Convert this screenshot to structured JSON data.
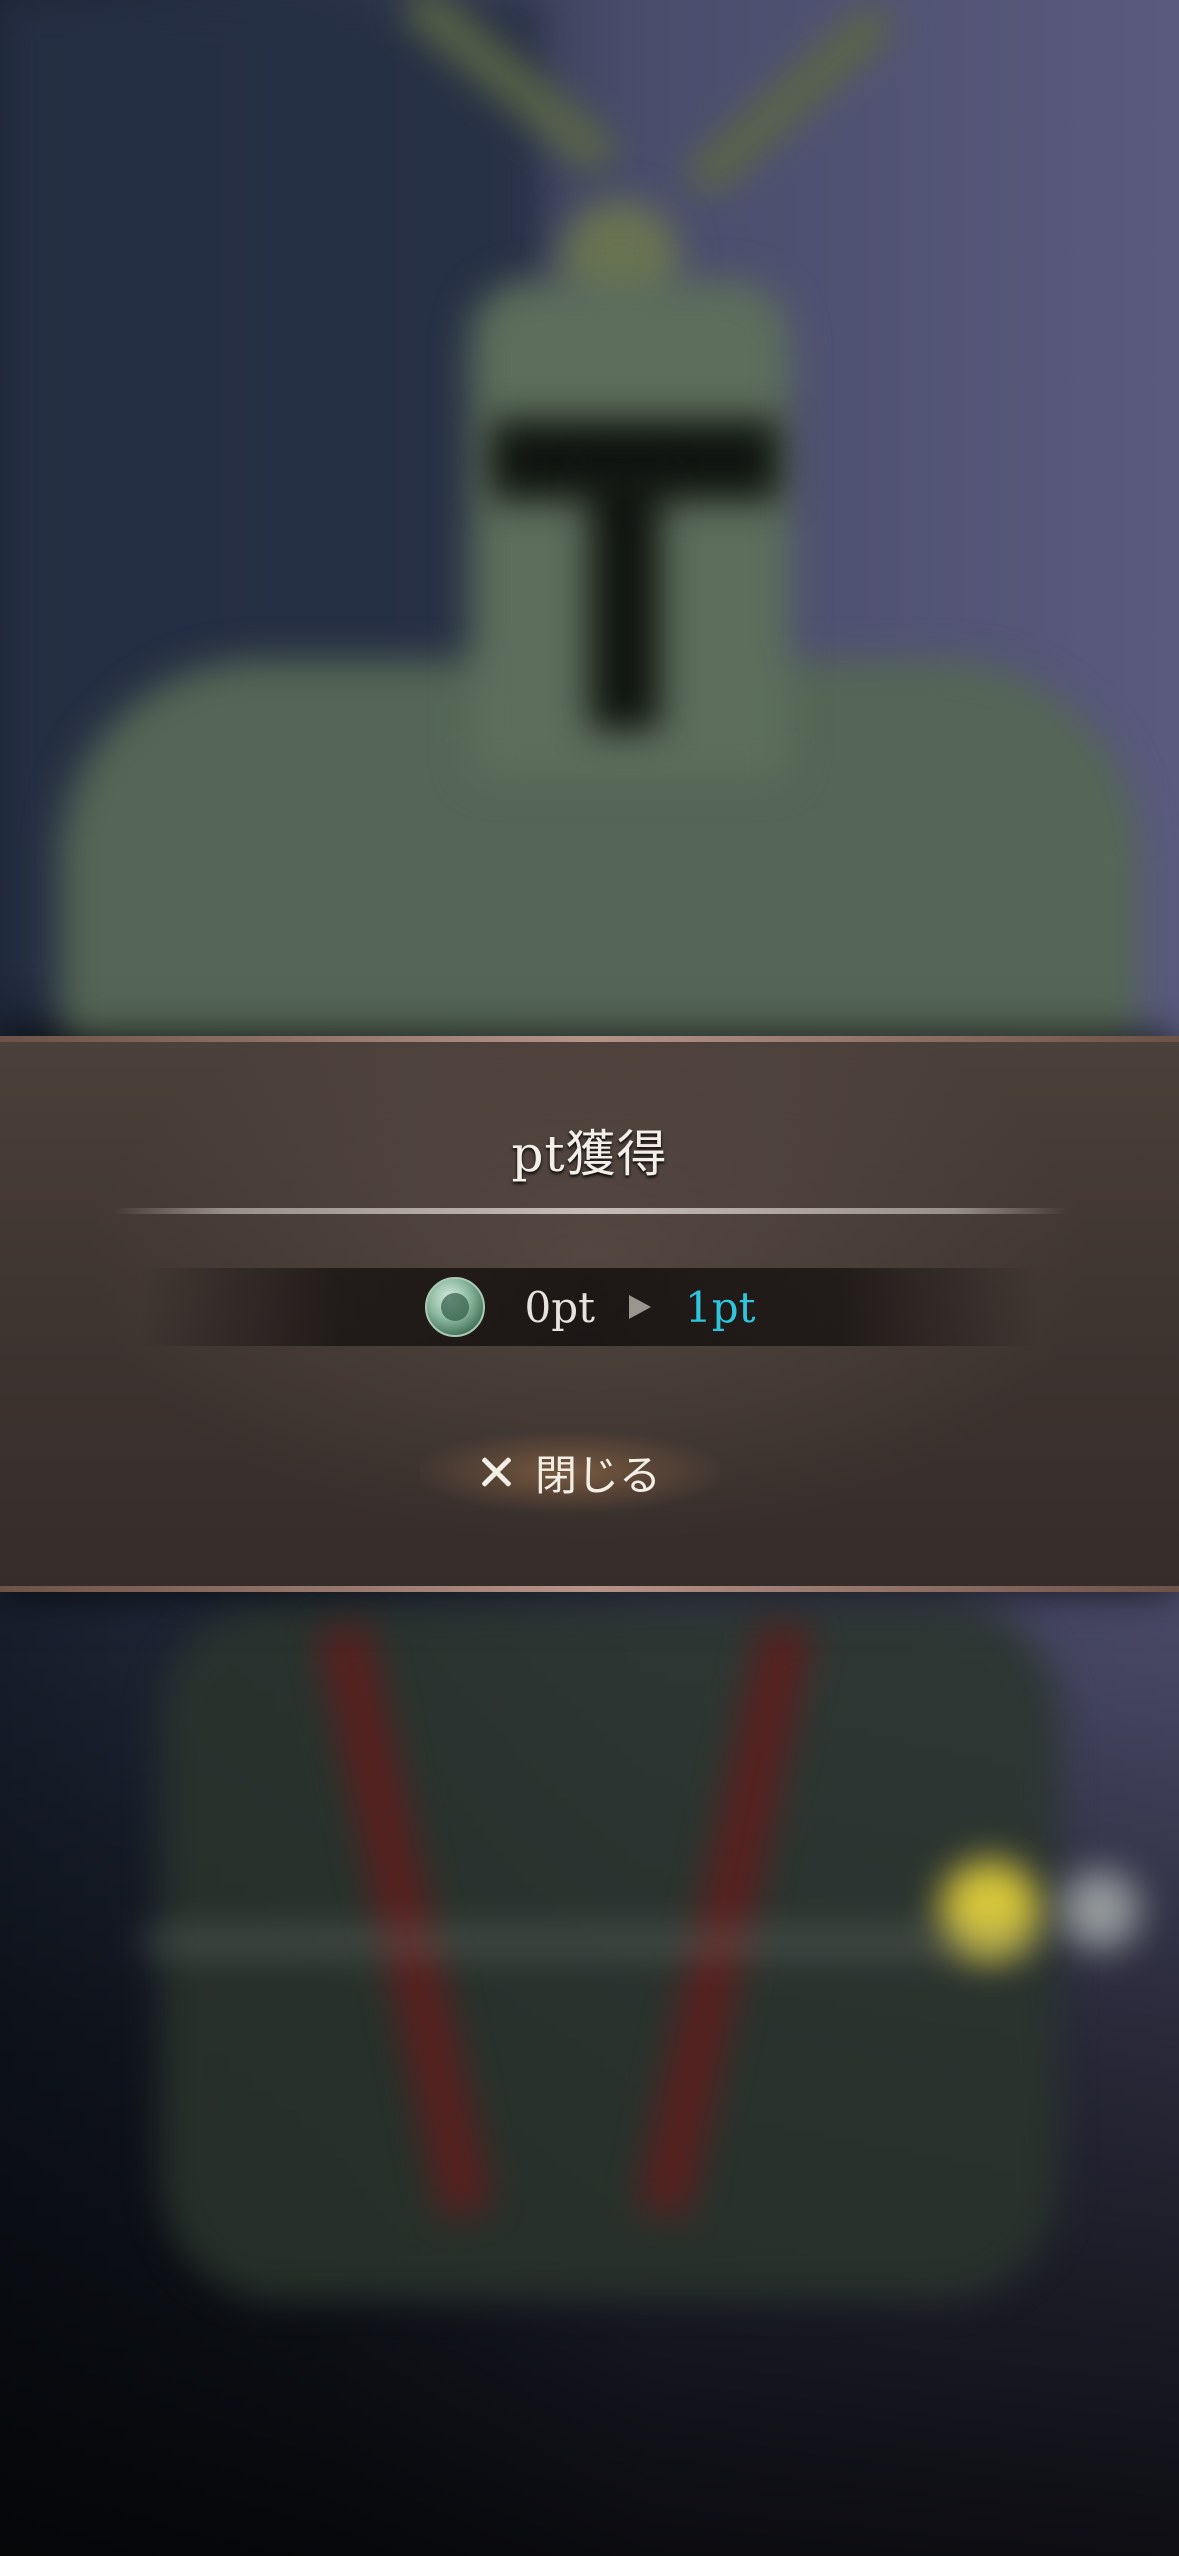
{
  "dialog": {
    "title": "pt獲得",
    "points": {
      "icon": "medal-coin-icon",
      "from": "0pt",
      "to": "1pt",
      "to_color": "#2fc6dd"
    },
    "close_label": "閉じる",
    "close_icon": "close-icon"
  }
}
